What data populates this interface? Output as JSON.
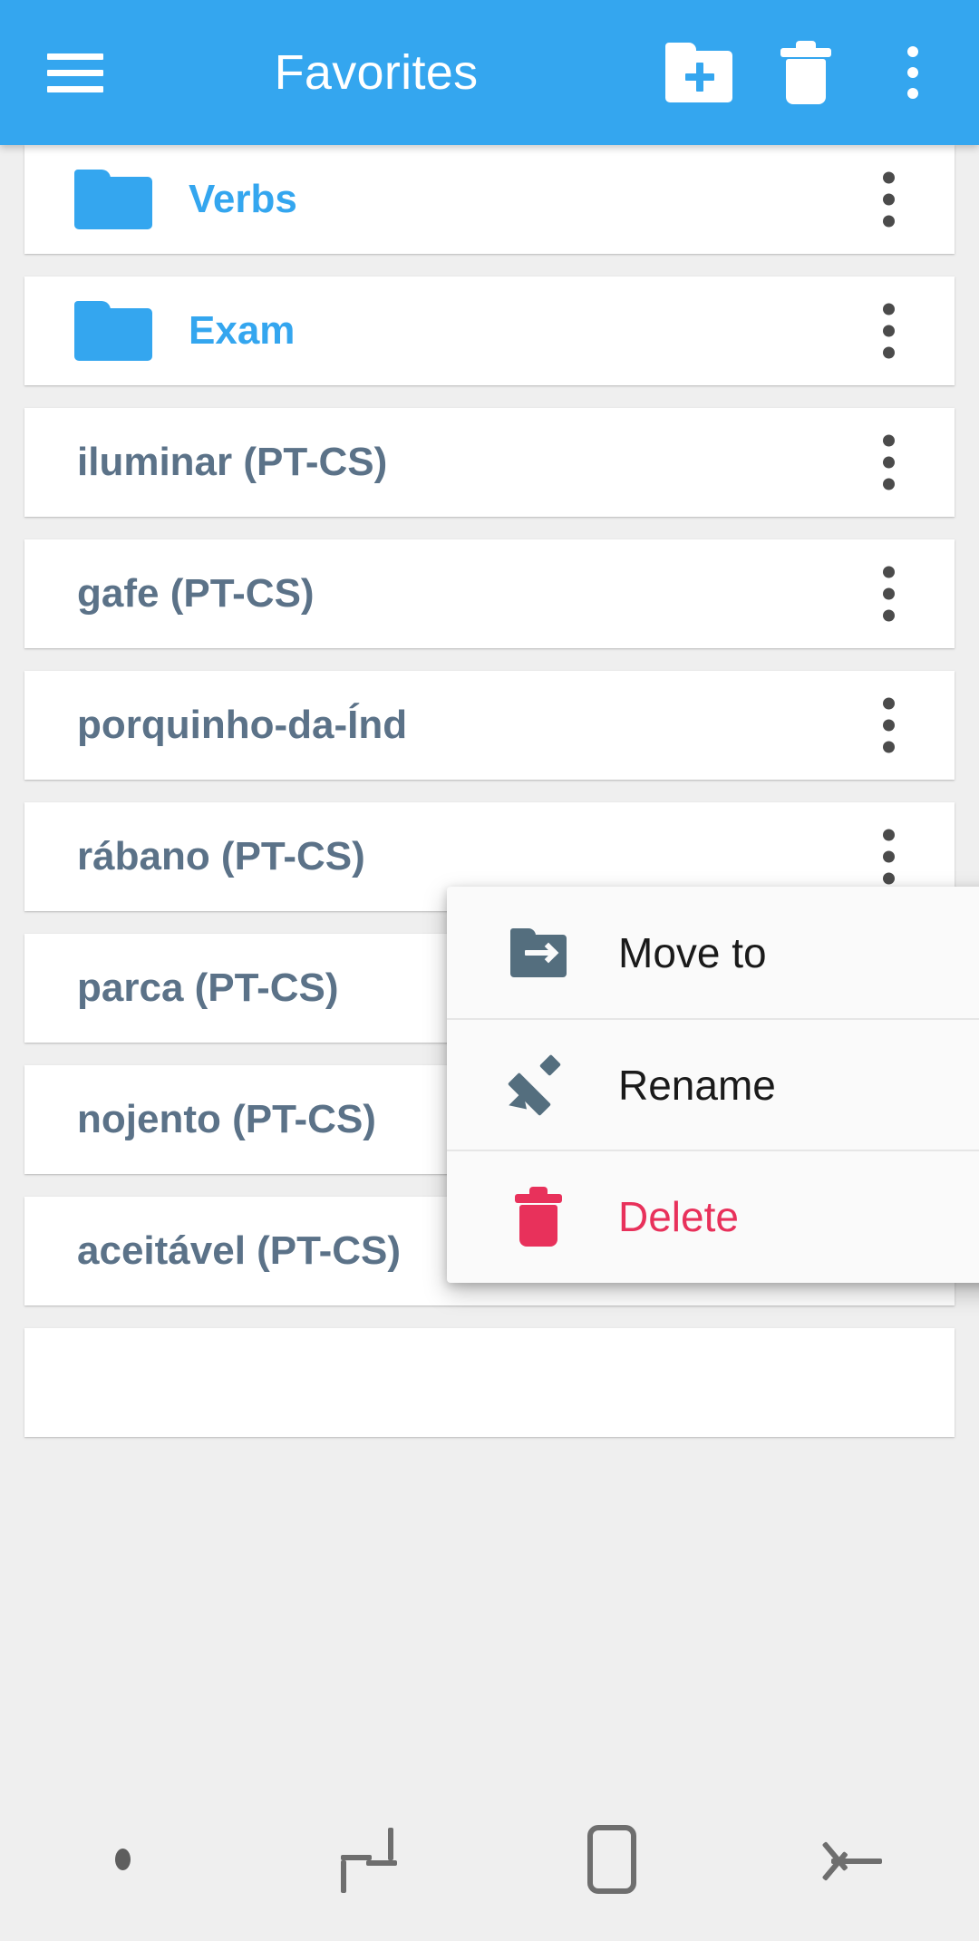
{
  "appbar": {
    "title": "Favorites",
    "menu_icon": "hamburger-menu-icon",
    "new_folder_icon": "new-folder-icon",
    "delete_icon": "trash-icon",
    "overflow_icon": "kebab-menu-icon",
    "background_color": "#34A6EF"
  },
  "list": {
    "items": [
      {
        "label": "Verbs",
        "type": "folder",
        "color": "#34A6EF"
      },
      {
        "label": "Exam",
        "type": "folder",
        "color": "#34A6EF"
      },
      {
        "label": "iluminar (PT-CS)",
        "type": "word",
        "color": "#5B7288"
      },
      {
        "label": "gafe (PT-CS)",
        "type": "word",
        "color": "#5B7288"
      },
      {
        "label": "porquinho-da-Índ",
        "type": "word",
        "color": "#5B7288"
      },
      {
        "label": "rábano (PT-CS)",
        "type": "word",
        "color": "#5B7288"
      },
      {
        "label": "parca (PT-CS)",
        "type": "word",
        "color": "#5B7288"
      },
      {
        "label": "nojento (PT-CS)",
        "type": "word",
        "color": "#5B7288"
      },
      {
        "label": "aceitável (PT-CS)",
        "type": "word",
        "color": "#5B7288"
      },
      {
        "label": "",
        "type": "word",
        "color": "#5B7288"
      }
    ],
    "row_overflow_icon": "kebab-menu-icon"
  },
  "context_menu": {
    "items": [
      {
        "label": "Move to",
        "icon": "move-to-folder-icon",
        "color": "#1A1A1A"
      },
      {
        "label": "Rename",
        "icon": "pencil-icon",
        "color": "#1A1A1A"
      },
      {
        "label": "Delete",
        "icon": "trash-icon",
        "color": "#E8315B"
      }
    ]
  },
  "navbar": {
    "items": [
      {
        "icon": "dot-indicator-icon"
      },
      {
        "icon": "recents-icon"
      },
      {
        "icon": "home-icon"
      },
      {
        "icon": "back-icon"
      }
    ]
  }
}
